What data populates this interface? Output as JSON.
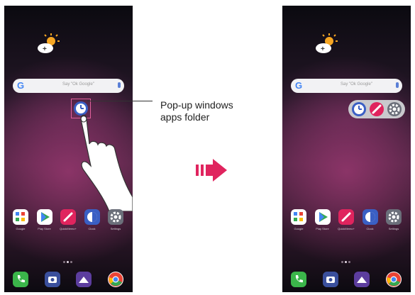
{
  "left_screen": {
    "search_hint": "Say \"Ok Google\"",
    "apps_row": [
      "Google",
      "Play Store",
      "QuickMemo+",
      "Clock",
      "Settings"
    ],
    "dock": [
      "phone-icon",
      "camera-icon",
      "gallery-icon",
      "chrome-icon"
    ]
  },
  "right_screen": {
    "search_hint": "Say \"Ok Google\"",
    "apps_row": [
      "Google",
      "Play Store",
      "QuickMemo+",
      "Clock",
      "Settings"
    ],
    "popup_folder_icons": [
      "clock-icon",
      "quickmemo-icon",
      "settings-icon"
    ],
    "dock": [
      "phone-icon",
      "camera-icon",
      "gallery-icon",
      "chrome-icon"
    ]
  },
  "callout": {
    "line1": "Pop-up windows",
    "line2": "apps folder"
  },
  "colors": {
    "arrow": "#e0245e",
    "folder_highlight": "#e0609a",
    "clock_blue": "#3a5fc4"
  }
}
